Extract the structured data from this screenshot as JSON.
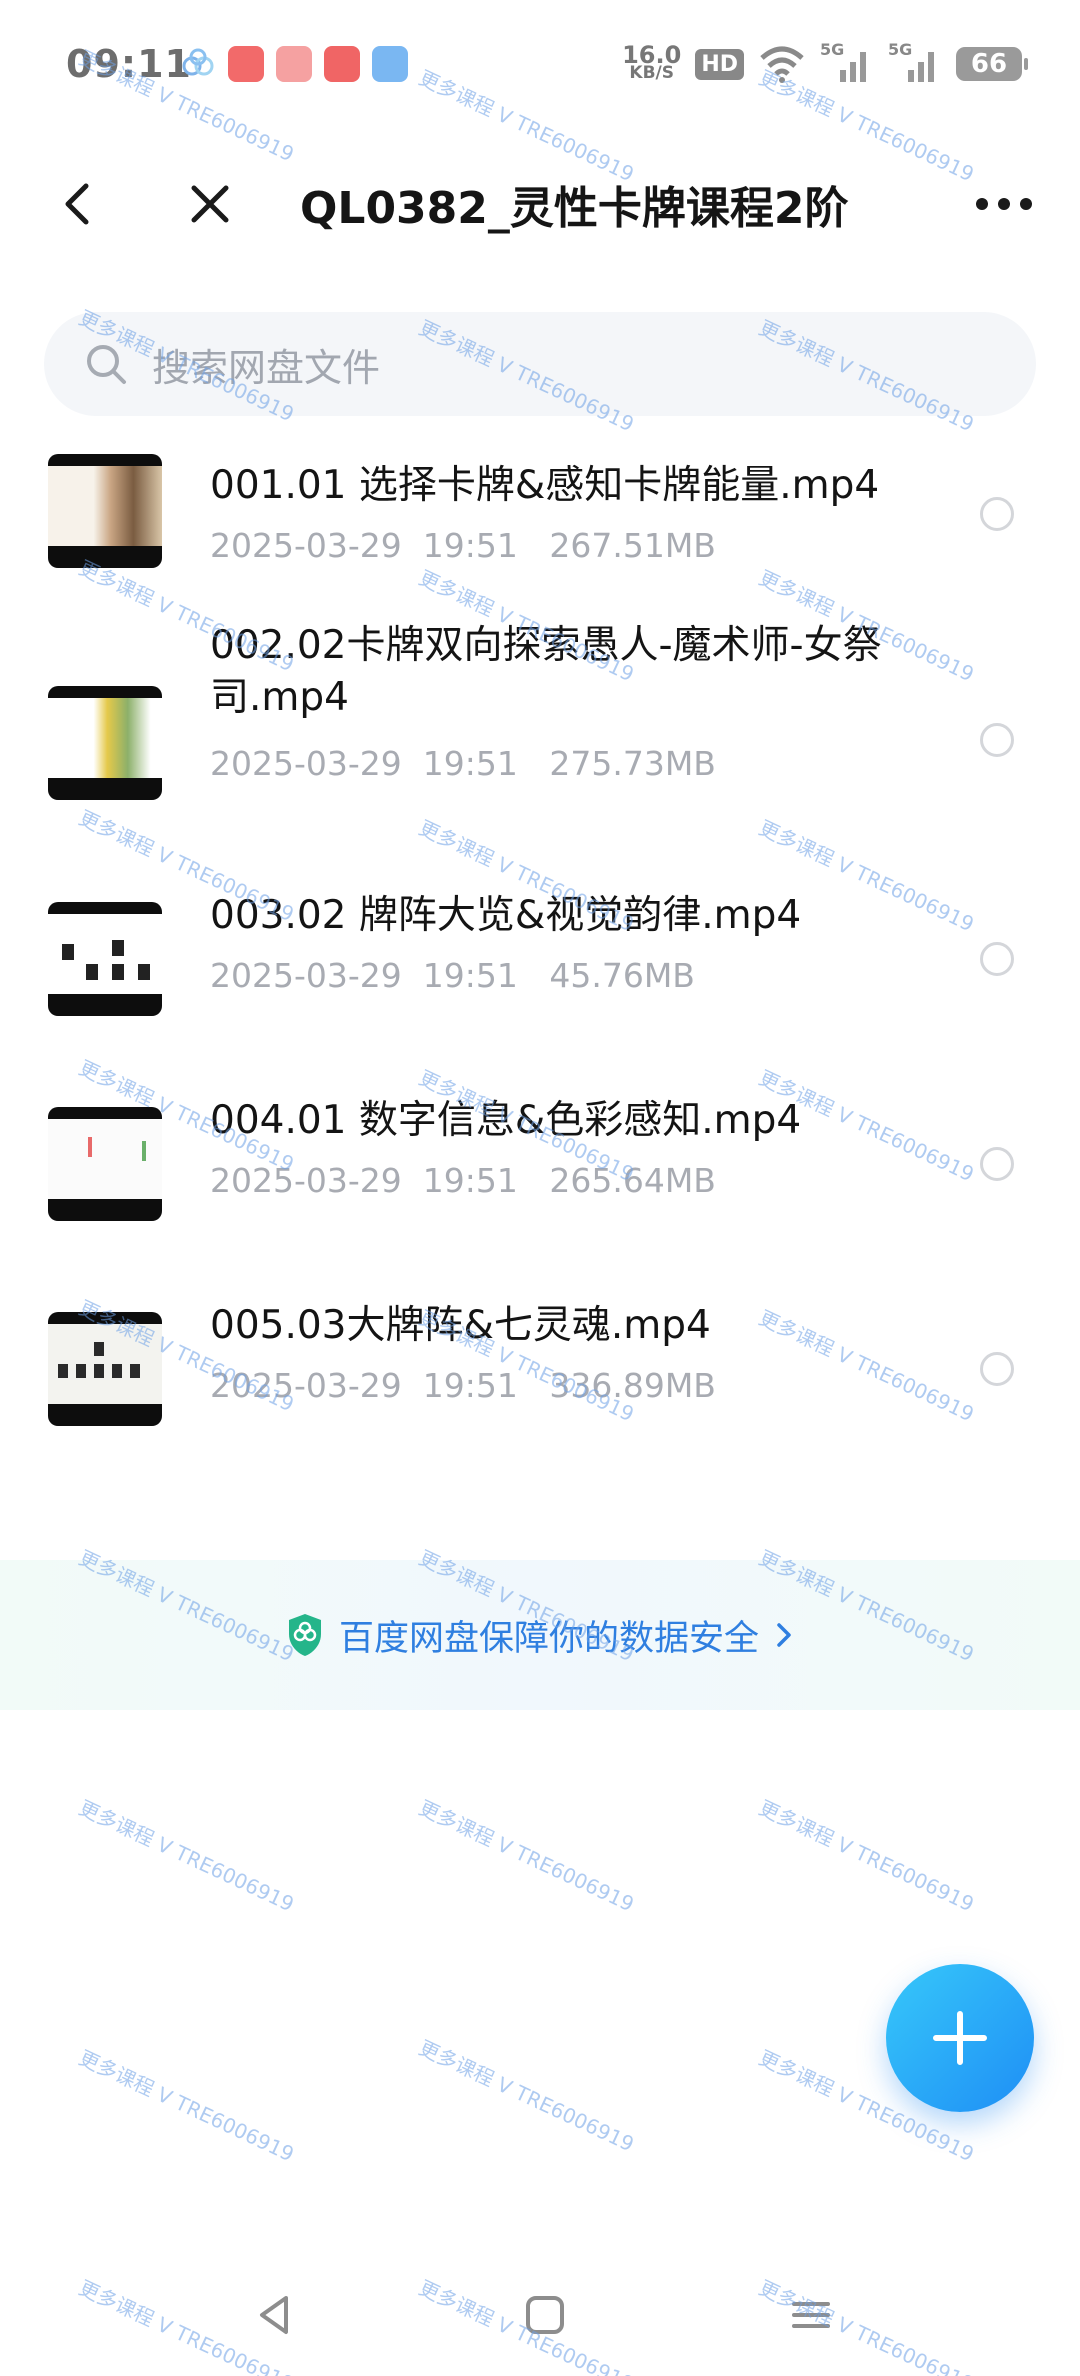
{
  "status_bar": {
    "time": "09:11",
    "net_speed_value": "16.0",
    "net_speed_unit": "KB/S",
    "hd_label": "HD",
    "signal_1_label": "5G",
    "signal_2_label": "5G",
    "battery_level": "66"
  },
  "header": {
    "title": "QL0382_灵性卡牌课程2阶"
  },
  "search": {
    "placeholder": "搜索网盘文件"
  },
  "files": [
    {
      "name": "001.01 选择卡牌&感知卡牌能量.mp4",
      "date": "2025-03-29  19:51",
      "size": "267.51MB"
    },
    {
      "name": "002.02卡牌双向探索愚人-魔术师-女祭司.mp4",
      "date": "2025-03-29  19:51",
      "size": "275.73MB"
    },
    {
      "name": "003.02 牌阵大览&视觉韵律.mp4",
      "date": "2025-03-29  19:51",
      "size": "45.76MB"
    },
    {
      "name": "004.01 数字信息&色彩感知.mp4",
      "date": "2025-03-29  19:51",
      "size": "265.64MB"
    },
    {
      "name": "005.03大牌阵&七灵魂.mp4",
      "date": "2025-03-29  19:51",
      "size": "336.89MB"
    }
  ],
  "security_banner": {
    "text": "百度网盘保障你的数据安全"
  },
  "watermark": {
    "text": "更多课程 V TRE6006919"
  },
  "colors": {
    "accent": "#2f7fe0",
    "fab_start": "#37c8fa",
    "fab_end": "#1e8ef5"
  },
  "icons": [
    "back-icon",
    "close-icon",
    "more-icon",
    "search-icon",
    "shield-icon",
    "chevron-right-icon",
    "plus-icon",
    "nav-back-icon",
    "nav-home-icon",
    "nav-menu-icon"
  ]
}
